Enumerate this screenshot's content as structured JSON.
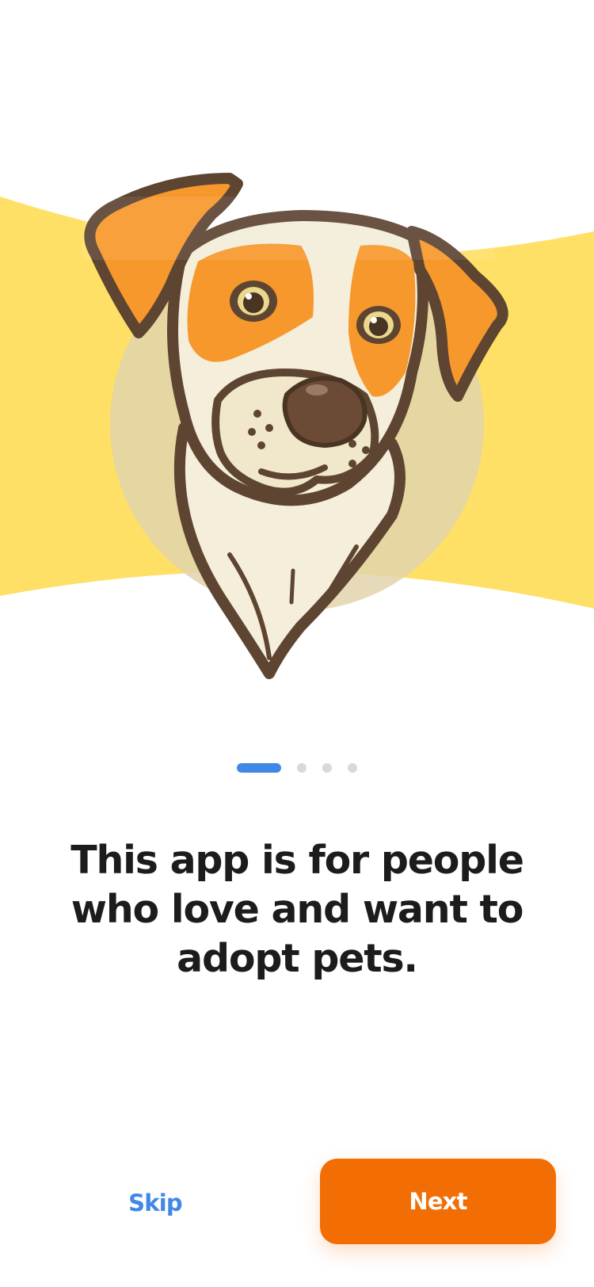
{
  "onboarding": {
    "headline": "This app is for people who love and want to adopt pets.",
    "current_page": 1,
    "total_pages": 4
  },
  "actions": {
    "skip_label": "Skip",
    "next_label": "Next"
  },
  "theme": {
    "accent_blue": "#4088E6",
    "accent_orange": "#F26E05",
    "banner_yellow": "#FFE066",
    "dot_inactive": "#D9D9D9",
    "text_dark": "#1C1C1C"
  },
  "illustration": {
    "subject": "dog-illustration"
  }
}
